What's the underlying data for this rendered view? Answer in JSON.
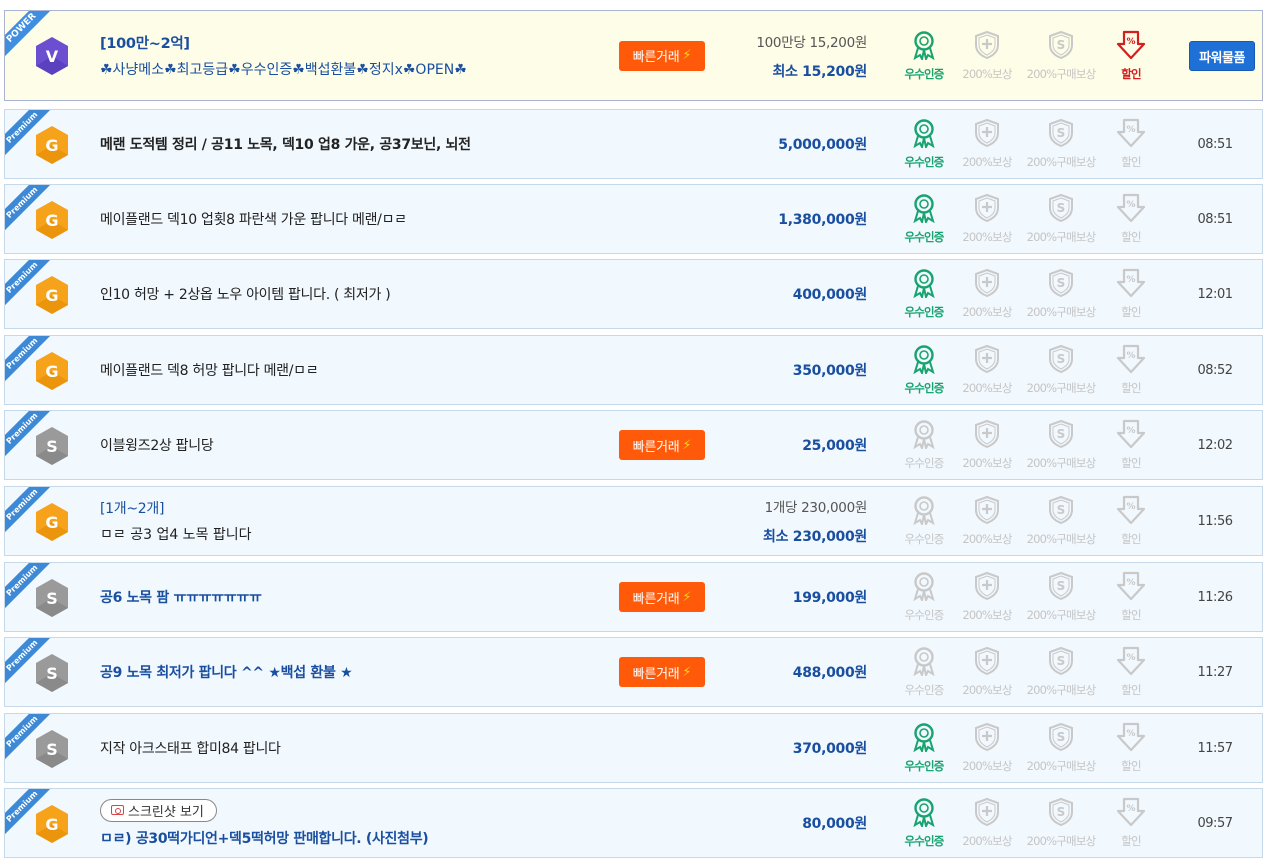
{
  "labels": {
    "fast_trade": "빠른거래",
    "cert": "우수인증",
    "comp": "200%보상",
    "buy": "200%구매보상",
    "disc": "할인",
    "power_item": "파워물품",
    "screenshot": "스크린샷 보기"
  },
  "colors": {
    "price_blue": "#1a4fa0",
    "fast_trade_orange": "#ff5a0a",
    "cert_green": "#18a36f",
    "discount_red": "#d51e1e",
    "ribbon_blue": "#3d89d6",
    "badge_gold": "#f7a21b",
    "badge_silver": "#9a9a9a",
    "badge_v_purple": "#6b4fd0"
  },
  "rows": [
    {
      "ribbon": "POWER",
      "badge": "V",
      "title": "[100만~2억]",
      "subtitle": "☘사냥메소☘최고등급☘우수인증☘백섭환불☘정지x☘OPEN☘",
      "fast_trade": true,
      "price_unit": "100만당 15,200원",
      "price": "최소 15,200원",
      "cert": true,
      "discount": true,
      "time": "",
      "power_button": true
    },
    {
      "ribbon": "Premium",
      "badge": "G",
      "title": "메랜 도적템 정리 / 공11 노목, 덱10 업8 가운, 공37보닌, 뇌전",
      "title_style": "bold",
      "fast_trade": false,
      "price": "5,000,000원",
      "cert": true,
      "discount": false,
      "time": "08:51"
    },
    {
      "ribbon": "Premium",
      "badge": "G",
      "title": "메이플랜드 덱10 업횟8 파란색 가운 팝니다 메랜/ㅁㄹ",
      "fast_trade": false,
      "price": "1,380,000원",
      "cert": true,
      "discount": false,
      "time": "08:51"
    },
    {
      "ribbon": "Premium",
      "badge": "G",
      "title": "인10 허망 + 2상옵 노우 아이템 팝니다. ( 최저가 )",
      "fast_trade": false,
      "price": "400,000원",
      "cert": true,
      "discount": false,
      "time": "12:01"
    },
    {
      "ribbon": "Premium",
      "badge": "G",
      "title": "메이플랜드 덱8 허망 팝니다 메랜/ㅁㄹ",
      "fast_trade": false,
      "price": "350,000원",
      "cert": true,
      "discount": false,
      "time": "08:52"
    },
    {
      "ribbon": "Premium",
      "badge": "S",
      "title": "이블윙즈2상 팝니당",
      "fast_trade": true,
      "price": "25,000원",
      "cert": false,
      "discount": false,
      "time": "12:02"
    },
    {
      "ribbon": "Premium",
      "badge": "G",
      "title": "[1개~2개]",
      "subtitle": "ㅁㄹ 공3 업4 노목 팝니다",
      "fast_trade": false,
      "price_unit": "1개당 230,000원",
      "price": "최소 230,000원",
      "cert": false,
      "discount": false,
      "time": "11:56"
    },
    {
      "ribbon": "Premium",
      "badge": "S",
      "title": "공6 노목 팜 ㅠㅠㅠㅠㅠㅠㅠ",
      "title_style": "blue",
      "fast_trade": true,
      "price": "199,000원",
      "cert": false,
      "discount": false,
      "time": "11:26"
    },
    {
      "ribbon": "Premium",
      "badge": "S",
      "title": "공9 노목 최저가 팝니다 ^^ ★백섭 환불 ★",
      "title_style": "blue",
      "fast_trade": true,
      "price": "488,000원",
      "cert": false,
      "discount": false,
      "time": "11:27"
    },
    {
      "ribbon": "Premium",
      "badge": "S",
      "title": "지작 아크스태프 합미84 팝니다",
      "fast_trade": false,
      "price": "370,000원",
      "cert": true,
      "discount": false,
      "time": "11:57"
    },
    {
      "ribbon": "Premium",
      "badge": "G",
      "screenshot": true,
      "title": "ㅁㄹ) 공30떡가디언+덱5떡허망 판매합니다. (사진첨부)",
      "title_style": "blue",
      "fast_trade": false,
      "price": "80,000원",
      "cert": true,
      "discount": false,
      "time": "09:57"
    }
  ]
}
